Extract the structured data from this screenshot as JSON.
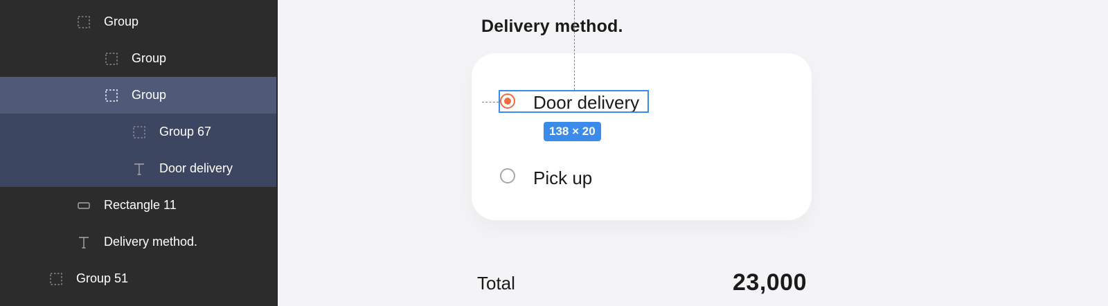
{
  "layers_panel": {
    "items": [
      {
        "label": "Group",
        "icon": "group-icon",
        "state": "normal"
      },
      {
        "label": "Group",
        "icon": "group-icon",
        "state": "normal"
      },
      {
        "label": "Group",
        "icon": "group-icon",
        "state": "selected"
      },
      {
        "label": "Group 67",
        "icon": "group-icon",
        "state": "child-selected"
      },
      {
        "label": "Door delivery",
        "icon": "text-icon",
        "state": "child-selected"
      },
      {
        "label": "Rectangle 11",
        "icon": "rectangle-icon",
        "state": "normal"
      },
      {
        "label": "Delivery method.",
        "icon": "text-icon",
        "state": "normal"
      },
      {
        "label": "Group 51",
        "icon": "group-icon",
        "state": "normal"
      }
    ]
  },
  "canvas": {
    "section_title": "Delivery method.",
    "options": [
      {
        "label": "Door delivery",
        "checked": true
      },
      {
        "label": "Pick up",
        "checked": false
      }
    ],
    "selection_size": "138 × 20",
    "total_label": "Total",
    "total_value": "23,000"
  },
  "colors": {
    "panel_bg": "#2c2c2c",
    "selected_row": "#4e5a78",
    "child_selected_row": "#3d4660",
    "accent_blue": "#3b8bea",
    "radio_checked": "#f26b3a"
  }
}
